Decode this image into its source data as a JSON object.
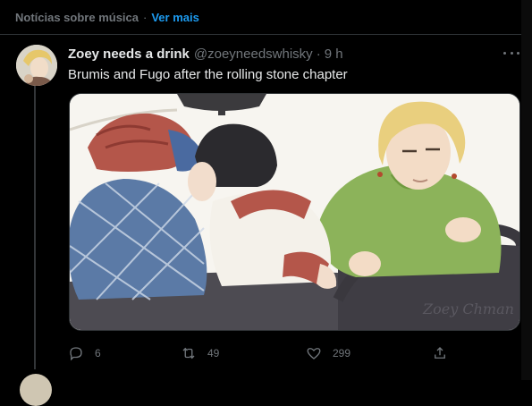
{
  "header": {
    "title": "Notícias sobre música",
    "separator": "·",
    "more_link": "Ver mais"
  },
  "tweet": {
    "display_name": "Zoey needs a drink",
    "handle": "@zoeyneedswhisky",
    "separator": "·",
    "time": "9 h",
    "text": "Brumis and Fugo after the rolling stone chapter",
    "media_signature": "Zoey Chman",
    "actions": {
      "replies": "6",
      "retweets": "49",
      "likes": "299"
    }
  },
  "icons": {
    "more": "more-horizontal-icon",
    "reply": "reply-icon",
    "retweet": "retweet-icon",
    "like": "heart-icon",
    "share": "share-icon"
  },
  "colors": {
    "background": "#000000",
    "text": "#e7e9ea",
    "muted": "#71767b",
    "accent": "#1d9bf0",
    "divider": "#2f3336"
  }
}
